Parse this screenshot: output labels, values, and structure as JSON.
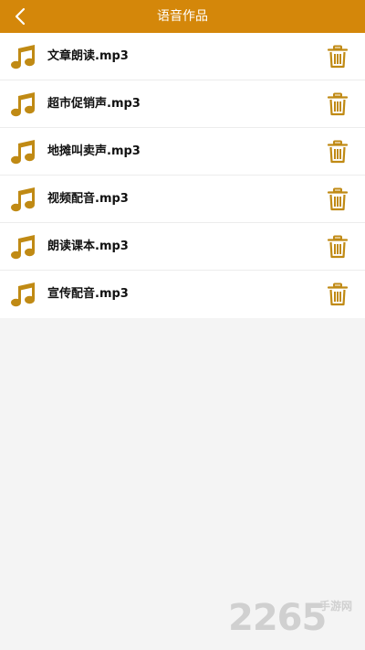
{
  "header": {
    "title": "语音作品",
    "background": "#d4870a"
  },
  "files": [
    {
      "name": "文章朗读.mp3",
      "icon": "music-note-icon",
      "action_icon": "trash-icon"
    },
    {
      "name": "超市促销声.mp3",
      "icon": "music-note-icon",
      "action_icon": "trash-icon"
    },
    {
      "name": "地摊叫卖声.mp3",
      "icon": "music-note-icon",
      "action_icon": "trash-icon"
    },
    {
      "name": "视频配音.mp3",
      "icon": "music-note-icon",
      "action_icon": "trash-icon"
    },
    {
      "name": "朗读课本.mp3",
      "icon": "music-note-icon",
      "action_icon": "trash-icon"
    },
    {
      "name": "宣传配音.mp3",
      "icon": "music-note-icon",
      "action_icon": "trash-icon"
    }
  ],
  "colors": {
    "accent": "#d4870a",
    "icon_gold": "#c08a14",
    "background": "#f4f4f4"
  },
  "watermark": {
    "number": "2265",
    "text": "手游网"
  }
}
